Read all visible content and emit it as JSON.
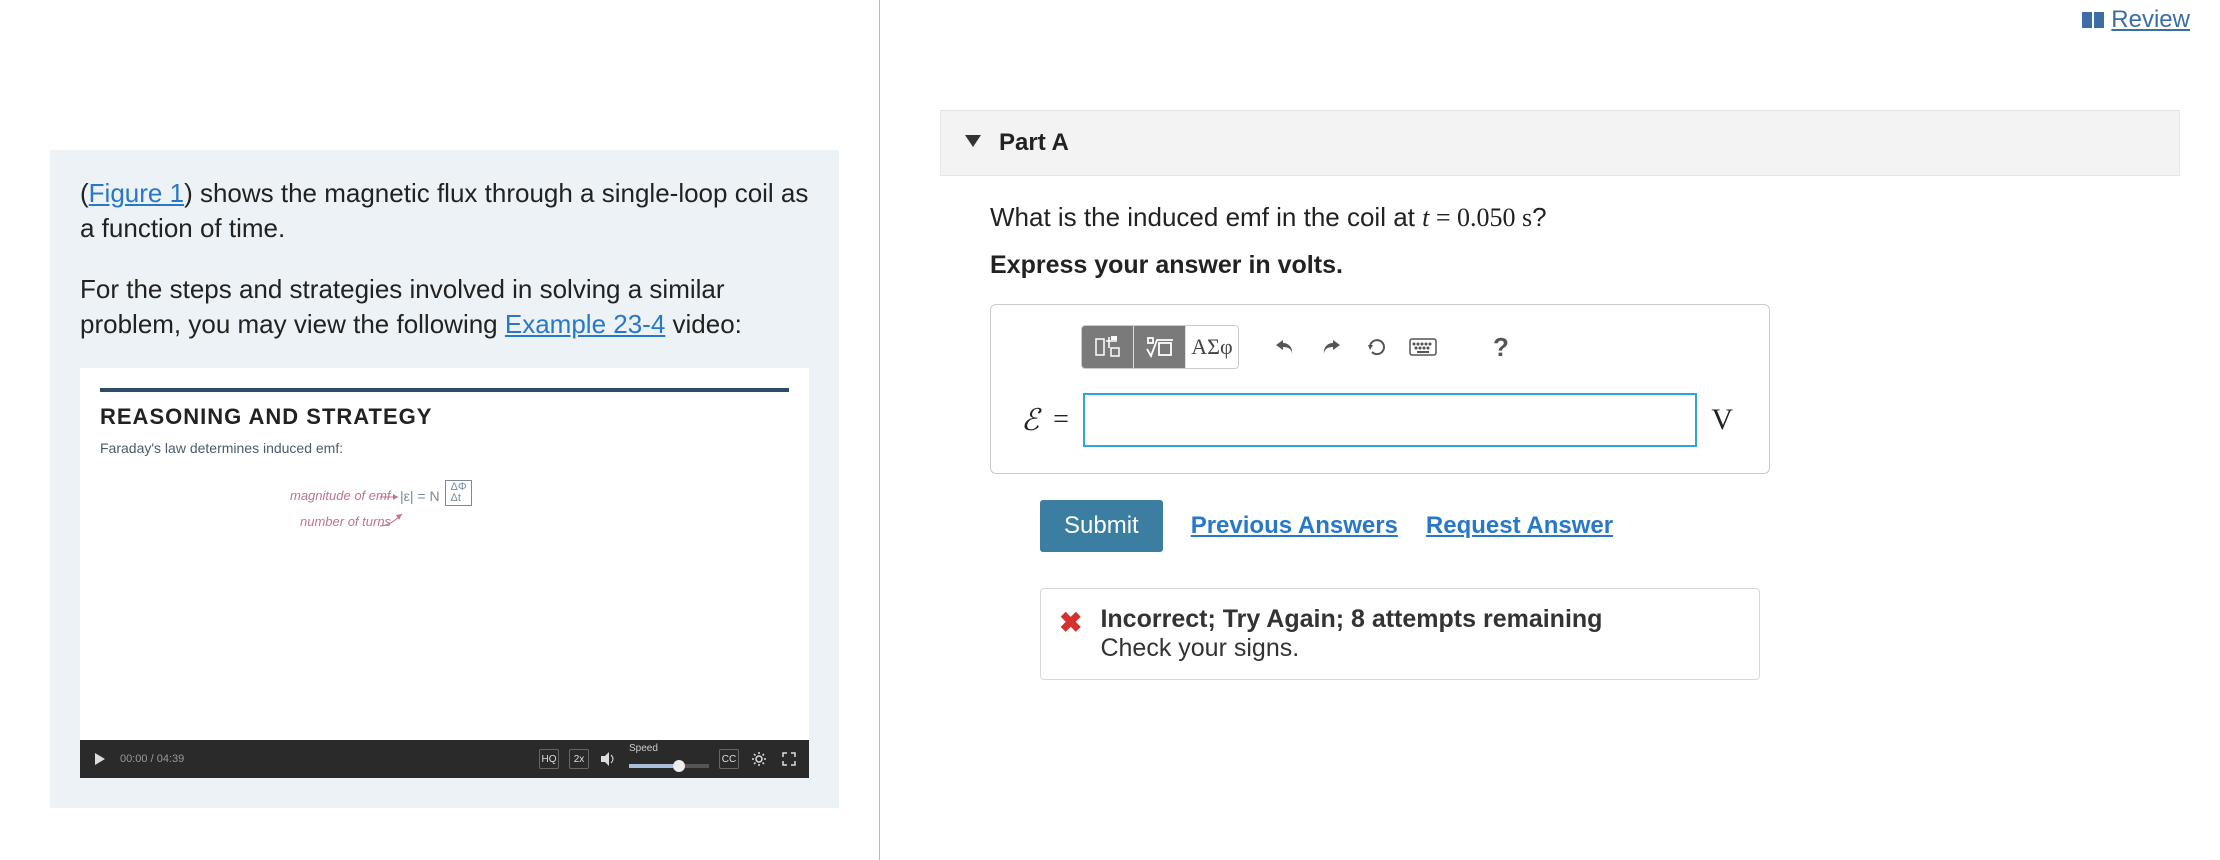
{
  "review": {
    "label": "Review"
  },
  "left": {
    "figure_link": "Figure 1",
    "intro_tail": ") shows the magnetic flux through a single-loop coil as a function of time.",
    "para2_head": "For the steps and strategies involved in solving a similar problem, you may view the following ",
    "example_link": "Example 23-4",
    "para2_tail": " video:",
    "video": {
      "title": "REASONING AND STRATEGY",
      "subtitle": "Faraday's law determines induced emf:",
      "label_magnitude": "magnitude of emf",
      "label_turns": "number of turns",
      "eq_lhs": "|ε| = N",
      "eq_rhs_num": "ΔΦ",
      "eq_rhs_den": "Δt",
      "time_current": "00:00",
      "time_total": "04:39",
      "speed_label": "Speed"
    }
  },
  "part": {
    "title": "Part A",
    "question_pre": "What is the induced emf in the coil at ",
    "question_var": "t",
    "question_eq": " = ",
    "question_val": "0.050 s",
    "question_post": "?",
    "instruction": "Express your answer in volts.",
    "toolbar": {
      "template": "",
      "sqrt": "√",
      "greek": "ΑΣφ",
      "undo": "↶",
      "redo": "↷",
      "reset": "↻",
      "keyboard": "⌨",
      "help": "?"
    },
    "answer": {
      "symbol": "ℰ",
      "equals": "=",
      "value": "",
      "unit": "V"
    },
    "submit": "Submit",
    "prev_answers": "Previous Answers",
    "request_answer": "Request Answer",
    "feedback": {
      "line1": "Incorrect; Try Again; 8 attempts remaining",
      "line2": "Check your signs."
    }
  }
}
